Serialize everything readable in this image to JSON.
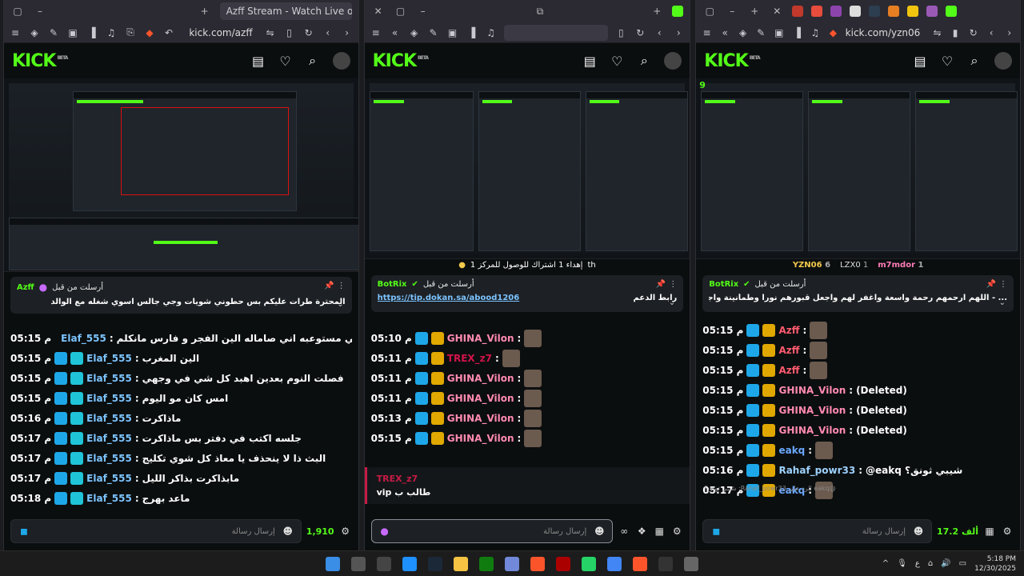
{
  "windows": [
    {
      "tab_title": "Azff Stream - Watch Live on Kick",
      "url": "kick.com/azff",
      "pinned": {
        "label": "أرسلت من قبل",
        "user": "Azff",
        "text": "المحترة طرات عليكم بس حطوني شويات وجي جالس اسوي شغله مع الوالد"
      },
      "messages": [
        {
          "time": "05:15 م",
          "user": "Elaf_555",
          "color": "#7cc4ff",
          "text": "ماني مستوعبه اني صاماله الين الفجر و فارس مانكلم"
        },
        {
          "time": "05:15 م",
          "user": "Elaf_555",
          "color": "#7cc4ff",
          "text": "الين المغرب"
        },
        {
          "time": "05:15 م",
          "user": "Elaf_555",
          "color": "#7cc4ff",
          "text": "فصلت النوم بعدين اهبد كل شي في وجهي"
        },
        {
          "time": "05:15 م",
          "user": "Elaf_555",
          "color": "#7cc4ff",
          "text": "امس كان مو اليوم"
        },
        {
          "time": "05:16 م",
          "user": "Elaf_555",
          "color": "#7cc4ff",
          "text": "ماذاكرت"
        },
        {
          "time": "05:17 م",
          "user": "Elaf_555",
          "color": "#7cc4ff",
          "text": "جلسه اكتب في دفتر بس ماذاكرت"
        },
        {
          "time": "05:17 م",
          "user": "Elaf_555",
          "color": "#7cc4ff",
          "text": "البث ذا لا ينحذف يا معاذ كل شوي تكليج"
        },
        {
          "time": "05:17 م",
          "user": "Elaf_555",
          "color": "#7cc4ff",
          "text": "مابذاكرت بذاكر الليل"
        },
        {
          "time": "05:18 م",
          "user": "Elaf_555",
          "color": "#7cc4ff",
          "text": "ماعد بهرج"
        }
      ],
      "composer": {
        "placeholder": "إرسال رسالة",
        "points": "1,910"
      }
    },
    {
      "tab_title": "",
      "url": "",
      "goal_text": "إهداء 1 اشتراك للوصول للمركز 1",
      "goal_suffix": "th",
      "pinned": {
        "label": "أرسلت من قبل",
        "user": "BotRix",
        "link_label": "رابط الدعم",
        "link": "https://tip.dokan.sa/abood1206"
      },
      "messages": [
        {
          "time": "05:10 م",
          "user": "GHINA_Vilon",
          "color": "#ff8ab0",
          "text": ""
        },
        {
          "time": "05:11 م",
          "user": "TREX_z7",
          "color": "#d1144a",
          "text": ""
        },
        {
          "time": "05:11 م",
          "user": "GHINA_Vilon",
          "color": "#ff8ab0",
          "text": ""
        },
        {
          "time": "05:11 م",
          "user": "GHINA_Vilon",
          "color": "#ff8ab0",
          "text": ""
        },
        {
          "time": "05:13 م",
          "user": "GHINA_Vilon",
          "color": "#ff8ab0",
          "text": ""
        },
        {
          "time": "05:15 م",
          "user": "GHINA_Vilon",
          "color": "#ff8ab0",
          "text": ""
        }
      ],
      "reply": {
        "user": "TREX_z7",
        "text": "vip طالب ب"
      },
      "composer": {
        "placeholder": "إرسال رسالة"
      }
    },
    {
      "tab_title": "",
      "url": "kick.com/yzn06",
      "viewer_badge": "9",
      "toppers": [
        {
          "name": "YZN06",
          "value": "6"
        },
        {
          "name": "LZX0",
          "value": "1"
        },
        {
          "name": "m7mdor",
          "value": "1"
        }
      ],
      "pinned": {
        "label": "أرسلت من قبل",
        "user": "BotRix",
        "text": "... - اللهم ارحمهم رحمة واسعة واغفر لهم واجعل قبورهم نورا وطمأنينة واجمعنا بهم في جنتك بلا حساب ولا عذاب"
      },
      "messages": [
        {
          "time": "05:15 م",
          "user": "Azff",
          "color": "#ff5a6e",
          "text": ""
        },
        {
          "time": "05:15 م",
          "user": "Azff",
          "color": "#ff5a6e",
          "text": ""
        },
        {
          "time": "05:15 م",
          "user": "Azff",
          "color": "#ff5a6e",
          "text": ""
        },
        {
          "time": "05:15 م",
          "user": "GHINA_Vilon",
          "color": "#ff8ab0",
          "text": "(Deleted)"
        },
        {
          "time": "05:15 م",
          "user": "GHINA_Vilon",
          "color": "#ff8ab0",
          "text": "(Deleted)"
        },
        {
          "time": "05:15 م",
          "user": "GHINA_Vilon",
          "color": "#ff8ab0",
          "text": "(Deleted)"
        },
        {
          "time": "05:15 م",
          "user": "eakq",
          "color": "#6aa8ff",
          "text": ""
        },
        {
          "time": "05:16 م",
          "user": "Rahaf_powr33",
          "color": "#9ed2ff",
          "text": "@eakq شيبي ثونق؟"
        },
        {
          "time": "05:17 م",
          "user": "eakq",
          "color": "#6aa8ff",
          "text": ""
        }
      ],
      "reply_hint": "@eakq الرد على Rahaf_powr33: شيبي ثونق؟",
      "composer": {
        "placeholder": "إرسال رسالة",
        "points": "17.2 ألف"
      }
    }
  ],
  "taskbar": {
    "time": "5:18 PM",
    "date": "12/30/2025",
    "lang": "ع"
  },
  "colors": {
    "kick_green": "#53fc18",
    "bg": "#0b0e0f"
  }
}
